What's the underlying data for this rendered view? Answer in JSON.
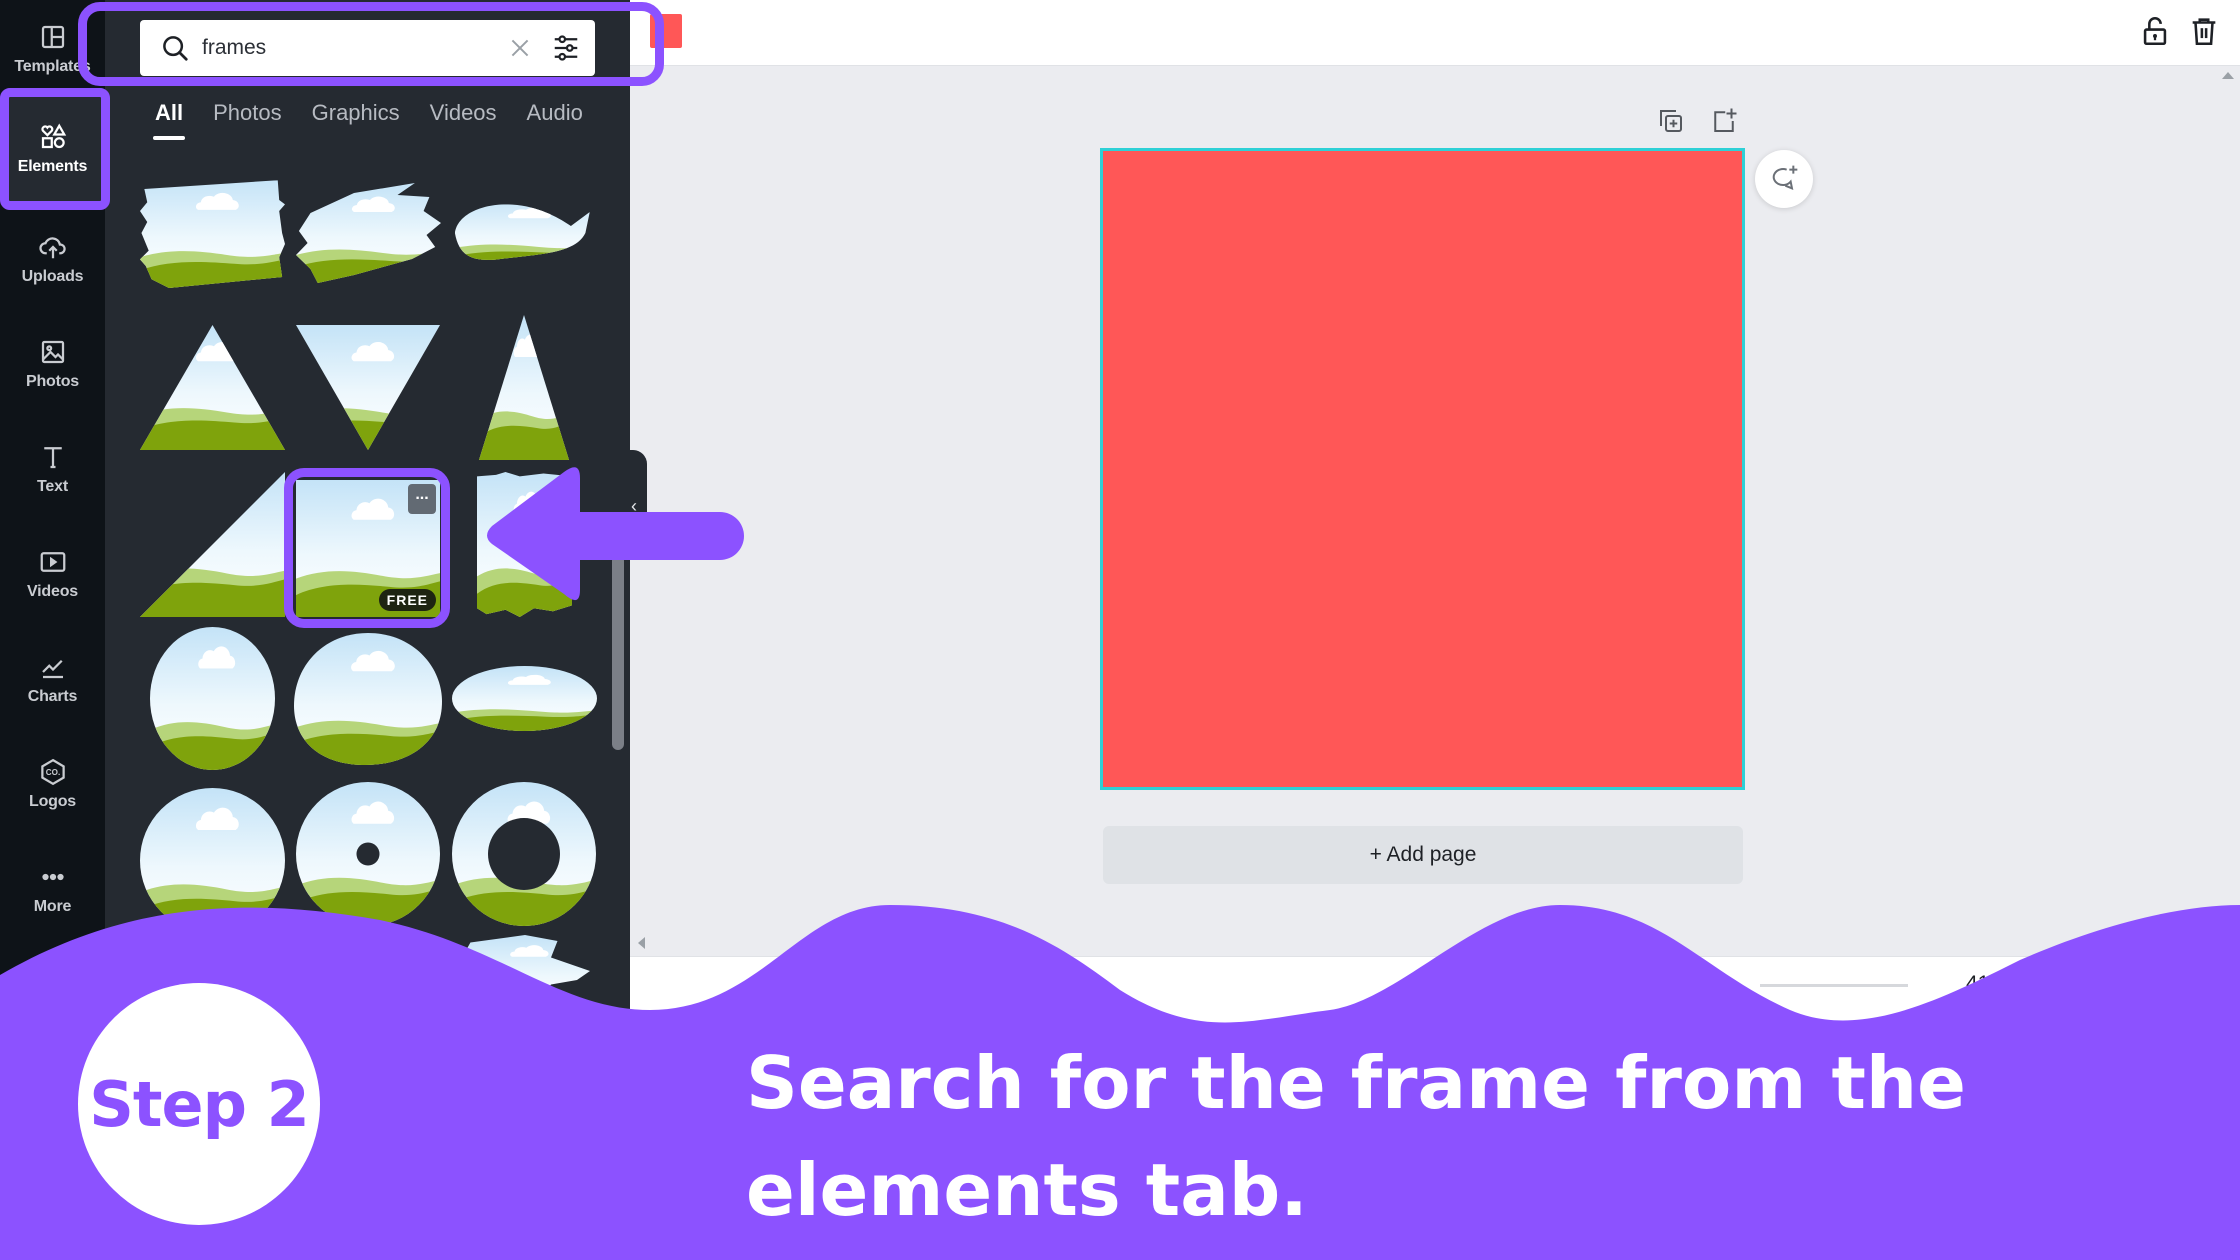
{
  "sidebar": {
    "items": [
      {
        "label": "Templates",
        "icon": "templates-icon"
      },
      {
        "label": "Elements",
        "icon": "elements-icon",
        "active": true
      },
      {
        "label": "Uploads",
        "icon": "upload-cloud-icon"
      },
      {
        "label": "Photos",
        "icon": "photo-icon"
      },
      {
        "label": "Text",
        "icon": "text-icon"
      },
      {
        "label": "Videos",
        "icon": "video-icon"
      },
      {
        "label": "Charts",
        "icon": "chart-line-icon"
      },
      {
        "label": "Logos",
        "icon": "logo-hexagon-icon"
      },
      {
        "label": "More",
        "icon": "more-dots-icon"
      }
    ]
  },
  "panel": {
    "search": {
      "value": "frames",
      "placeholder": ""
    },
    "tabs": [
      {
        "label": "All",
        "active": true
      },
      {
        "label": "Photos"
      },
      {
        "label": "Graphics"
      },
      {
        "label": "Videos"
      },
      {
        "label": "Audio"
      }
    ],
    "results": [
      {
        "shape": "brush-rectangle-frame"
      },
      {
        "shape": "brush-stroke-frame"
      },
      {
        "shape": "brush-swoosh-frame"
      },
      {
        "shape": "triangle-up-frame"
      },
      {
        "shape": "triangle-down-frame"
      },
      {
        "shape": "tall-triangle-frame"
      },
      {
        "shape": "right-triangle-frame"
      },
      {
        "shape": "square-frame",
        "badge": "FREE",
        "selected": true
      },
      {
        "shape": "torn-edge-frame"
      },
      {
        "shape": "egg-oval-frame"
      },
      {
        "shape": "blob-circle-frame"
      },
      {
        "shape": "wide-oval-frame"
      },
      {
        "shape": "circle-frame"
      },
      {
        "shape": "circle-dot-frame"
      },
      {
        "shape": "ring-frame"
      },
      {
        "shape": "brush-splash-frame"
      },
      {
        "shape": "brush-splash-frame-2"
      }
    ],
    "more_label": "..."
  },
  "canvas": {
    "add_page_label": "+ Add page",
    "zoom_level": "41%",
    "design_color": "#ff5757",
    "selection_color": "#2ed0d6"
  },
  "overlay": {
    "step_label": "Step 2",
    "caption": "Search for the frame from the elements tab.",
    "accent_color": "#8c52ff"
  }
}
